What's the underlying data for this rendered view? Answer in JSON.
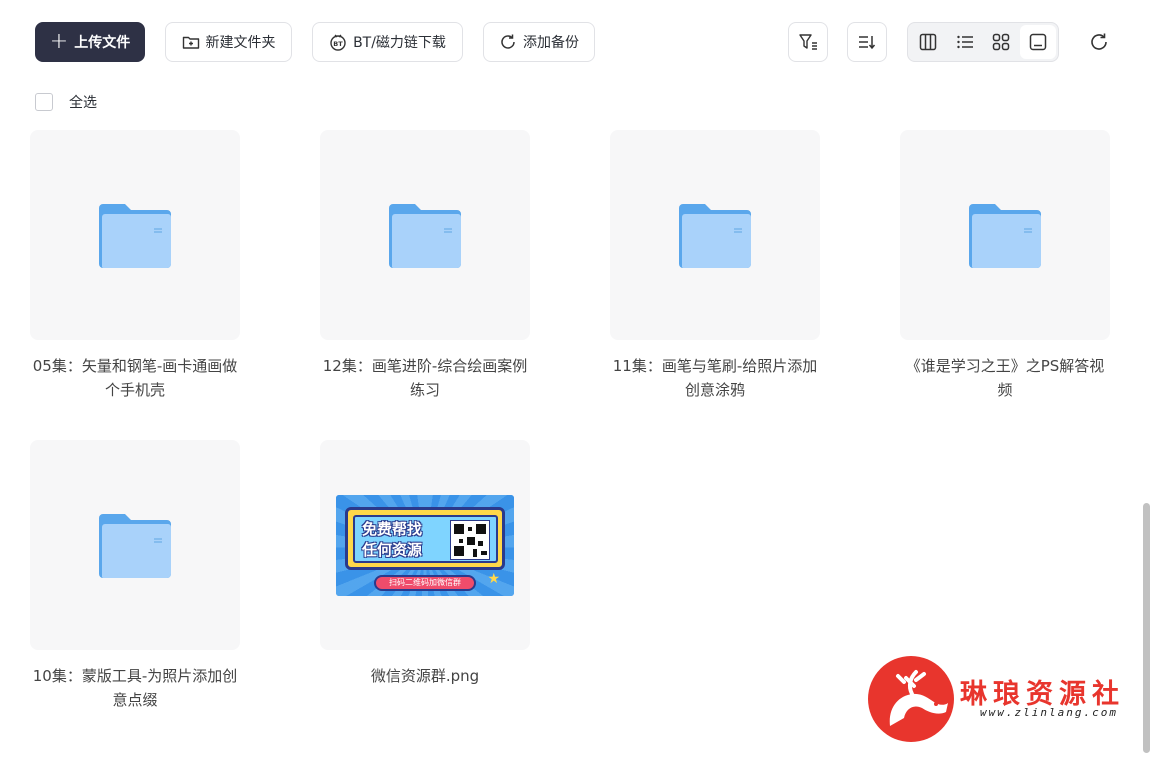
{
  "toolbar": {
    "upload_label": "上传文件",
    "new_folder_label": "新建文件夹",
    "bt_label": "BT/磁力链下载",
    "backup_label": "添加备份"
  },
  "select_all_label": "全选",
  "files": [
    {
      "name": "05集：矢量和钢笔-画卡通画做个手机壳",
      "type": "folder"
    },
    {
      "name": "12集：画笔进阶-综合绘画案例练习",
      "type": "folder"
    },
    {
      "name": "11集：画笔与笔刷-给照片添加创意涂鸦",
      "type": "folder"
    },
    {
      "name": "《谁是学习之王》之PS解答视频",
      "type": "folder"
    },
    {
      "name": "10集：蒙版工具-为照片添加创意点缀",
      "type": "folder"
    },
    {
      "name": "微信资源群.png",
      "type": "image"
    }
  ],
  "promo_image": {
    "headline_1": "免费帮找",
    "headline_2": "任何资源",
    "button": "扫码二维码加微信群"
  },
  "watermark": {
    "title": "琳琅资源社",
    "url": "www.zlinlang.com"
  },
  "colors": {
    "primary": "#2e3145",
    "folder": "#6db3f2",
    "brand_red": "#e8352d"
  }
}
